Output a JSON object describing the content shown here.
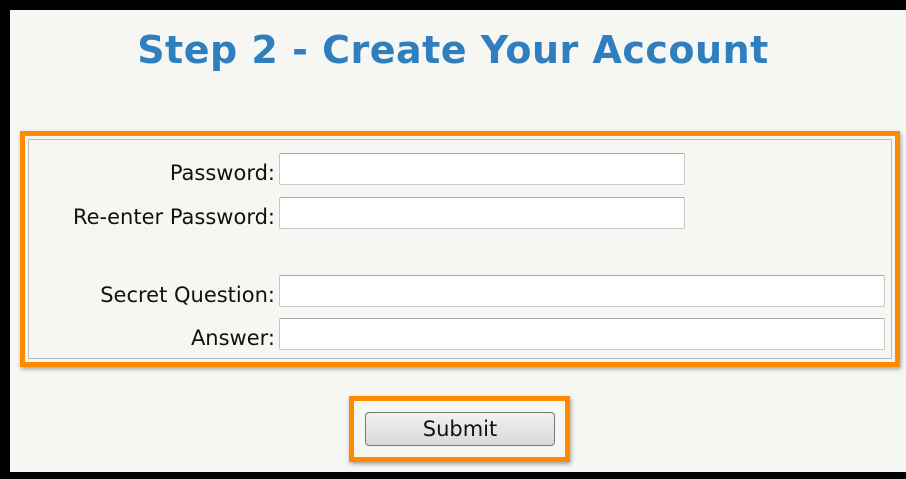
{
  "page": {
    "title": "Step 2 - Create Your Account"
  },
  "form": {
    "password": {
      "label": "Password:",
      "value": ""
    },
    "reenter_password": {
      "label": "Re-enter Password:",
      "value": ""
    },
    "secret_question": {
      "label": "Secret Question:",
      "value": ""
    },
    "answer": {
      "label": "Answer:",
      "value": ""
    }
  },
  "submit": {
    "label": "Submit"
  },
  "colors": {
    "title": "#2f7fbf",
    "highlight": "#ff8a00",
    "background": "#f6f6f3",
    "outer_border": "#000000"
  }
}
